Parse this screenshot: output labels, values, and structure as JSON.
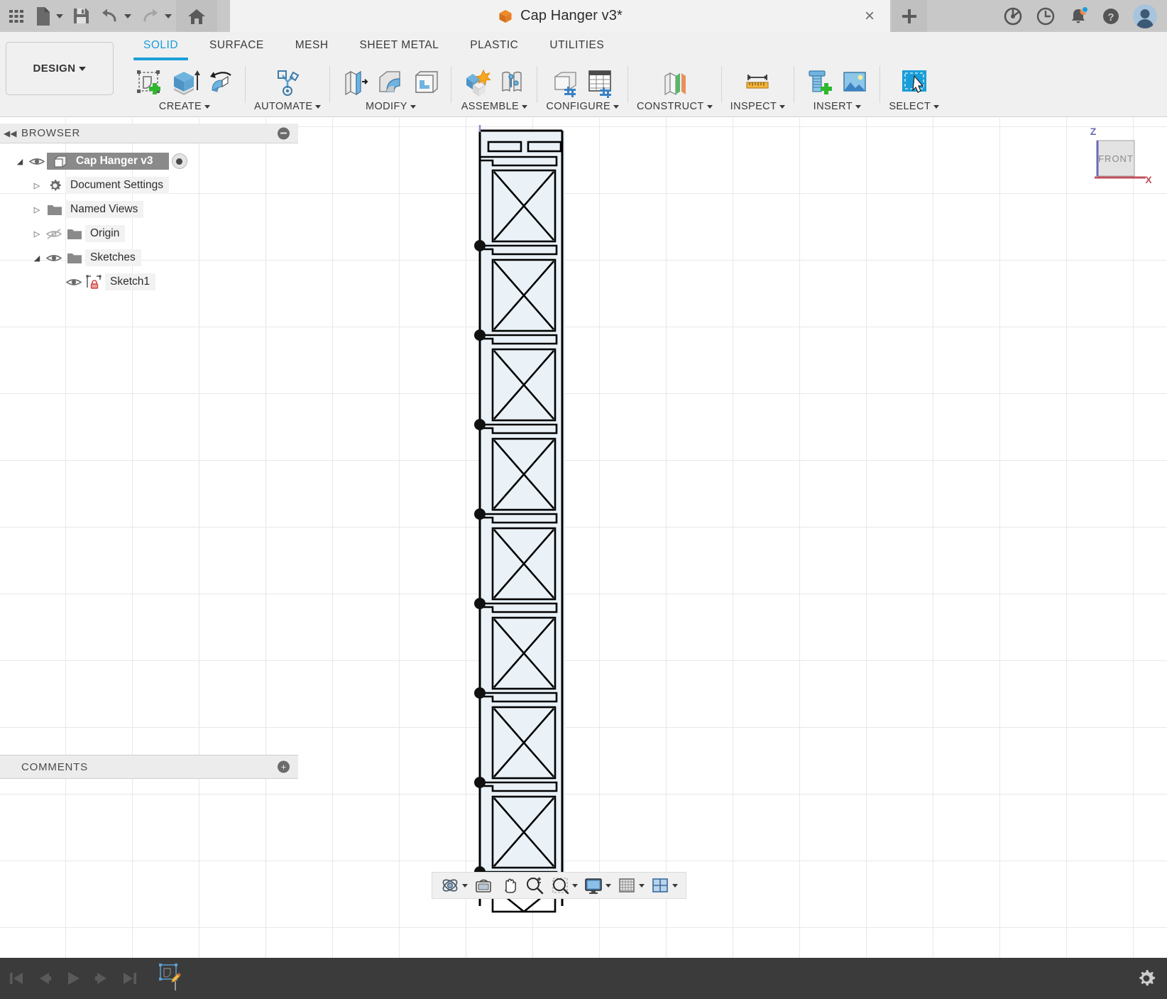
{
  "titlebar": {
    "app_grid_icon": "grid-apps-icon",
    "new_file_label": "new-file",
    "save_label": "save",
    "undo_label": "undo",
    "redo_label": "redo",
    "home_label": "home",
    "document_title": "Cap Hanger v3*",
    "document_icon": "orange-cube-icon",
    "close_label": "×",
    "new_tab_label": "+",
    "right_icons": [
      {
        "name": "extension-manager-icon",
        "glyph": ""
      },
      {
        "name": "job-status-clock-icon",
        "glyph": ""
      },
      {
        "name": "notifications-bell-icon",
        "glyph": "",
        "badge": true
      },
      {
        "name": "help-question-icon",
        "glyph": "?"
      },
      {
        "name": "user-avatar",
        "glyph": ""
      }
    ]
  },
  "ribbon": {
    "workspace_label": "DESIGN",
    "tabs": [
      {
        "label": "SOLID",
        "active": true
      },
      {
        "label": "SURFACE",
        "active": false
      },
      {
        "label": "MESH",
        "active": false
      },
      {
        "label": "SHEET METAL",
        "active": false
      },
      {
        "label": "PLASTIC",
        "active": false
      },
      {
        "label": "UTILITIES",
        "active": false
      }
    ],
    "panels": [
      {
        "label": "CREATE",
        "dropdown": true
      },
      {
        "label": "AUTOMATE",
        "dropdown": true
      },
      {
        "label": "MODIFY",
        "dropdown": true
      },
      {
        "label": "ASSEMBLE",
        "dropdown": true
      },
      {
        "label": "CONFIGURE",
        "dropdown": true
      },
      {
        "label": "CONSTRUCT",
        "dropdown": true
      },
      {
        "label": "INSPECT",
        "dropdown": true
      },
      {
        "label": "INSERT",
        "dropdown": true
      },
      {
        "label": "SELECT",
        "dropdown": true
      }
    ]
  },
  "browser": {
    "title": "BROWSER",
    "collapse_icon": "collapse-left-icon",
    "minimize_icon": "minimize-icon",
    "tree": [
      {
        "label": "Cap Hanger v3",
        "type": "root",
        "expanded": true,
        "visible": true,
        "selected": true,
        "has_radio": true,
        "indent": 0
      },
      {
        "label": "Document Settings",
        "type": "settings",
        "expanded": false,
        "visible": null,
        "selected": false,
        "indent": 1
      },
      {
        "label": "Named Views",
        "type": "folder",
        "expanded": false,
        "visible": null,
        "selected": false,
        "indent": 1
      },
      {
        "label": "Origin",
        "type": "folder",
        "expanded": false,
        "visible": false,
        "selected": false,
        "indent": 1
      },
      {
        "label": "Sketches",
        "type": "folder",
        "expanded": true,
        "visible": true,
        "selected": false,
        "indent": 1
      },
      {
        "label": "Sketch1",
        "type": "sketch",
        "expanded": null,
        "visible": true,
        "selected": false,
        "indent": 2
      }
    ]
  },
  "comments": {
    "title": "COMMENTS",
    "add_icon": "add-comment-icon"
  },
  "viewcube": {
    "face_label": "FRONT",
    "z_axis_label": "Z",
    "x_axis_label": "X",
    "z_color": "#6a6ab4",
    "x_color": "#c0505a"
  },
  "navbar": {
    "items": [
      {
        "name": "orbit-icon",
        "dropdown": true
      },
      {
        "name": "look-at-icon",
        "dropdown": false
      },
      {
        "name": "pan-hand-icon",
        "dropdown": false
      },
      {
        "name": "zoom-icon",
        "dropdown": false
      },
      {
        "name": "zoom-window-icon",
        "dropdown": true
      },
      {
        "name": "display-settings-icon",
        "dropdown": true
      },
      {
        "name": "grid-snaps-icon",
        "dropdown": true
      },
      {
        "name": "viewports-icon",
        "dropdown": true
      }
    ]
  },
  "timeline": {
    "buttons": [
      {
        "name": "go-to-beginning-button",
        "glyph": "skip-start"
      },
      {
        "name": "step-back-button",
        "glyph": "step-back"
      },
      {
        "name": "play-button",
        "glyph": "play"
      },
      {
        "name": "step-forward-button",
        "glyph": "step-forward"
      },
      {
        "name": "go-to-end-button",
        "glyph": "skip-end"
      }
    ],
    "feature_icon": "sketch-feature-icon",
    "settings_icon": "timeline-settings-gear-icon"
  },
  "model": {
    "name": "cap-hanger-sketch",
    "sketch_color": "#000000",
    "profile_fill": "#eaf2f8",
    "point_color": "#1a1a1a",
    "section_count": 8,
    "section_height": 125,
    "body_width": 124,
    "point_count": 8
  }
}
